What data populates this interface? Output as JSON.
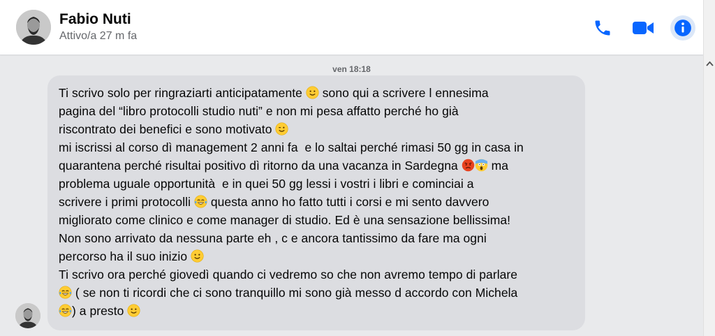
{
  "header": {
    "name": "Fabio Nuti",
    "status": "Attivo/a 27 m fa",
    "accent_color": "#0866ff",
    "icons": [
      "phone-icon",
      "video-camera-icon",
      "info-icon"
    ]
  },
  "thread": {
    "timestamp": "ven 18:18",
    "message": {
      "segments": [
        {
          "t": "Ti scrivo solo per ringraziarti anticipatamente "
        },
        {
          "e": "slightly-smiling-face-emoji"
        },
        {
          "t": " sono qui a scrivere l ennesima\npagina del “libro protocolli studio nuti” e non mi pesa affatto perché ho già\nriscontrato dei benefici e sono motivato "
        },
        {
          "e": "winking-face-emoji"
        },
        {
          "t": "\nmi iscrissi al corso dì management 2 anni fa  e lo saltai perché rimasi 50 gg in casa in\nquarantena perché risultai positivo dì ritorno da una vacanza in Sardegna "
        },
        {
          "e": "angry-face-emoji"
        },
        {
          "e": "screaming-face-emoji"
        },
        {
          "t": " ma\nproblema uguale opportunità  e in quei 50 gg lessi i vostri i libri e cominciai a\nscrivere i primi protocolli "
        },
        {
          "e": "tears-of-joy-emoji"
        },
        {
          "t": " questa anno ho fatto tutti i corsi e mi sento davvero\nmigliorato come clinico e come manager di studio. Ed è una sensazione bellissima!\nNon sono arrivato da nessuna parte eh , c e ancora tantissimo da fare ma ogni\npercorso ha il suo inizio "
        },
        {
          "e": "slightly-smiling-face-emoji"
        },
        {
          "t": "\nTi scrivo ora perché giovedì quando ci vedremo so che non avremo tempo di parlare\n"
        },
        {
          "e": "tears-of-joy-emoji"
        },
        {
          "t": " ( se non ti ricordi che ci sono tranquillo mi sono già messo d accordo con Michela\n"
        },
        {
          "e": "tears-of-joy-emoji"
        },
        {
          "t": ") a presto "
        },
        {
          "e": "slightly-smiling-face-emoji"
        }
      ]
    }
  },
  "colors": {
    "bubble": "#dcdde1",
    "background": "#e9eaec",
    "secondary_text": "#65676b"
  }
}
